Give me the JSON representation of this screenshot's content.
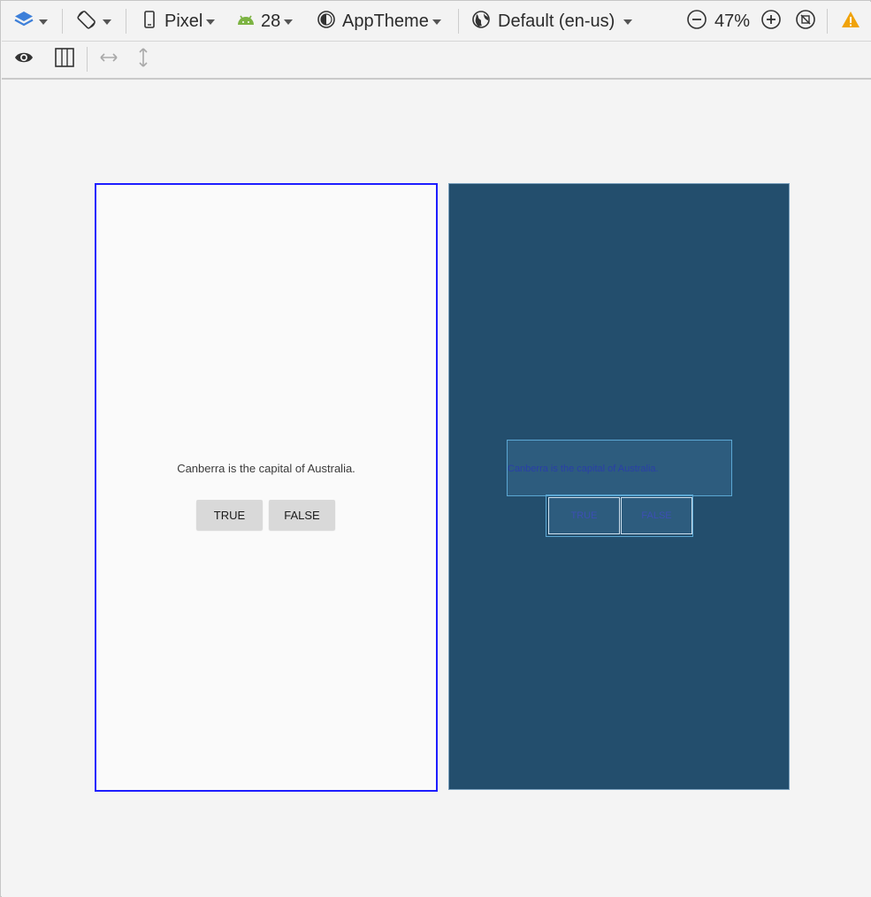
{
  "toolbar": {
    "device_label": "Pixel",
    "api_label": "28",
    "theme_label": "AppTheme",
    "locale_label": "Default (en-us)",
    "zoom_label": "47%"
  },
  "design_view": {
    "question_text": "Canberra is the capital of Australia.",
    "true_button": "TRUE",
    "false_button": "FALSE"
  },
  "blueprint_view": {
    "question_text": "Canberra is the capital of Australia.",
    "true_button": "TRUE",
    "false_button": "FALSE"
  },
  "colors": {
    "selection_border": "#1d1dff",
    "blueprint_bg": "#234e6d",
    "android_green": "#7cb342",
    "layers_blue": "#3d7fd9",
    "warning_yellow": "#f0a30a"
  }
}
